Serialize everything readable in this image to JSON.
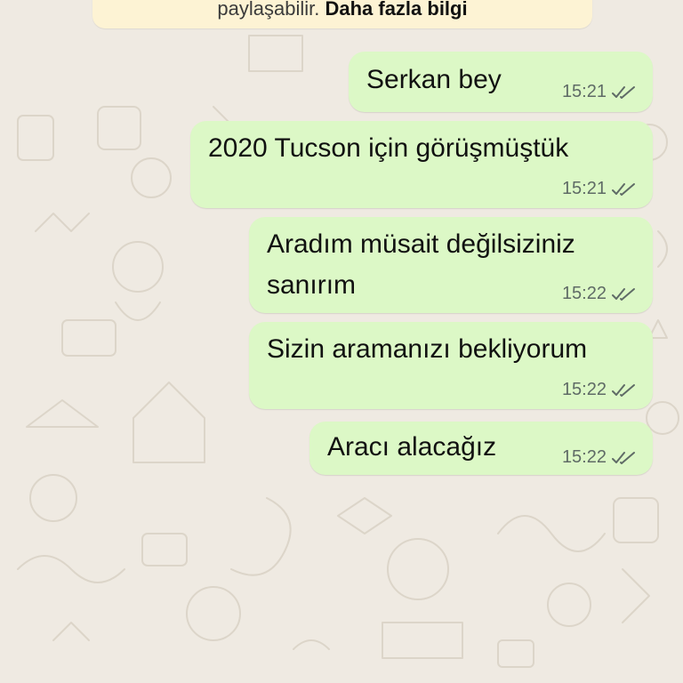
{
  "notice": {
    "text": "paylaşabilir.",
    "link": "Daha fazla bilgi"
  },
  "messages": [
    {
      "text": "Serkan bey",
      "time": "15:21",
      "status": "read"
    },
    {
      "text": "2020 Tucson için görüşmüştük",
      "time": "15:21",
      "status": "read"
    },
    {
      "text_line1": "Aradım müsait değilsiziniz",
      "text_line2": "sanırım",
      "time": "15:22",
      "status": "read"
    },
    {
      "text": "Sizin aramanızı bekliyorum",
      "time": "15:22",
      "status": "read"
    },
    {
      "text": "Aracı alacağız",
      "time": "15:22",
      "status": "read"
    }
  ],
  "colors": {
    "background": "#efeae2",
    "outgoing_bubble": "#dcf8c6",
    "notice_bg": "#fdf3d4",
    "meta_text": "#5f6b66"
  }
}
